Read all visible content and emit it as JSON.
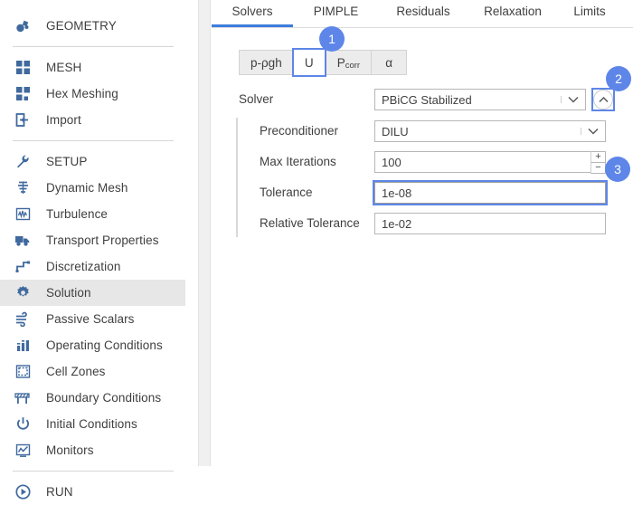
{
  "sidebar": {
    "groups": [
      {
        "items": [
          {
            "label": "GEOMETRY",
            "icon": "geometry-icon",
            "selected": false
          }
        ]
      },
      {
        "items": [
          {
            "label": "MESH",
            "icon": "mesh-grid-icon",
            "selected": false
          },
          {
            "label": "Hex Meshing",
            "icon": "hex-mesh-icon",
            "selected": false
          },
          {
            "label": "Import",
            "icon": "import-icon",
            "selected": false
          }
        ]
      },
      {
        "items": [
          {
            "label": "SETUP",
            "icon": "wrench-icon",
            "selected": false
          },
          {
            "label": "Dynamic Mesh",
            "icon": "dynamic-mesh-icon",
            "selected": false
          },
          {
            "label": "Turbulence",
            "icon": "turbulence-icon",
            "selected": false
          },
          {
            "label": "Transport Properties",
            "icon": "truck-icon",
            "selected": false
          },
          {
            "label": "Discretization",
            "icon": "discretization-icon",
            "selected": false
          },
          {
            "label": "Solution",
            "icon": "gear-icon",
            "selected": true
          },
          {
            "label": "Passive Scalars",
            "icon": "passive-scalars-icon",
            "selected": false
          },
          {
            "label": "Operating Conditions",
            "icon": "bar-chart-icon",
            "selected": false
          },
          {
            "label": "Cell Zones",
            "icon": "cell-zones-icon",
            "selected": false
          },
          {
            "label": "Boundary Conditions",
            "icon": "boundary-conditions-icon",
            "selected": false
          },
          {
            "label": "Initial Conditions",
            "icon": "power-icon",
            "selected": false
          },
          {
            "label": "Monitors",
            "icon": "monitor-chart-icon",
            "selected": false
          }
        ]
      },
      {
        "items": [
          {
            "label": "RUN",
            "icon": "play-icon",
            "selected": false
          }
        ]
      }
    ]
  },
  "tabs": [
    {
      "label": "Solvers",
      "active": true
    },
    {
      "label": "PIMPLE",
      "active": false
    },
    {
      "label": "Residuals",
      "active": false
    },
    {
      "label": "Relaxation",
      "active": false
    },
    {
      "label": "Limits",
      "active": false
    }
  ],
  "subtabs": [
    {
      "label": "p-ρgh",
      "sub": "",
      "selected": false
    },
    {
      "label": "U",
      "sub": "",
      "selected": true
    },
    {
      "label": "P",
      "sub": "corr",
      "selected": false
    },
    {
      "label": "α",
      "sub": "",
      "selected": false
    }
  ],
  "form": {
    "solver": {
      "label": "Solver",
      "value": "PBiCG Stabilized"
    },
    "preconditioner": {
      "label": "Preconditioner",
      "value": "DILU"
    },
    "max_iterations": {
      "label": "Max Iterations",
      "value": "100",
      "increment": "+",
      "decrement": "−"
    },
    "tolerance": {
      "label": "Tolerance",
      "value": "1e-08",
      "focused": true
    },
    "relative_tolerance": {
      "label": "Relative Tolerance",
      "value": "1e-02"
    }
  },
  "badges": [
    {
      "number": "1"
    },
    {
      "number": "2"
    },
    {
      "number": "3"
    }
  ],
  "colors": {
    "accent_blue": "#5e86e8",
    "tab_underline": "#3d7ddd",
    "icon_blue": "#40699e",
    "selected_row": "#e7e7e7"
  }
}
